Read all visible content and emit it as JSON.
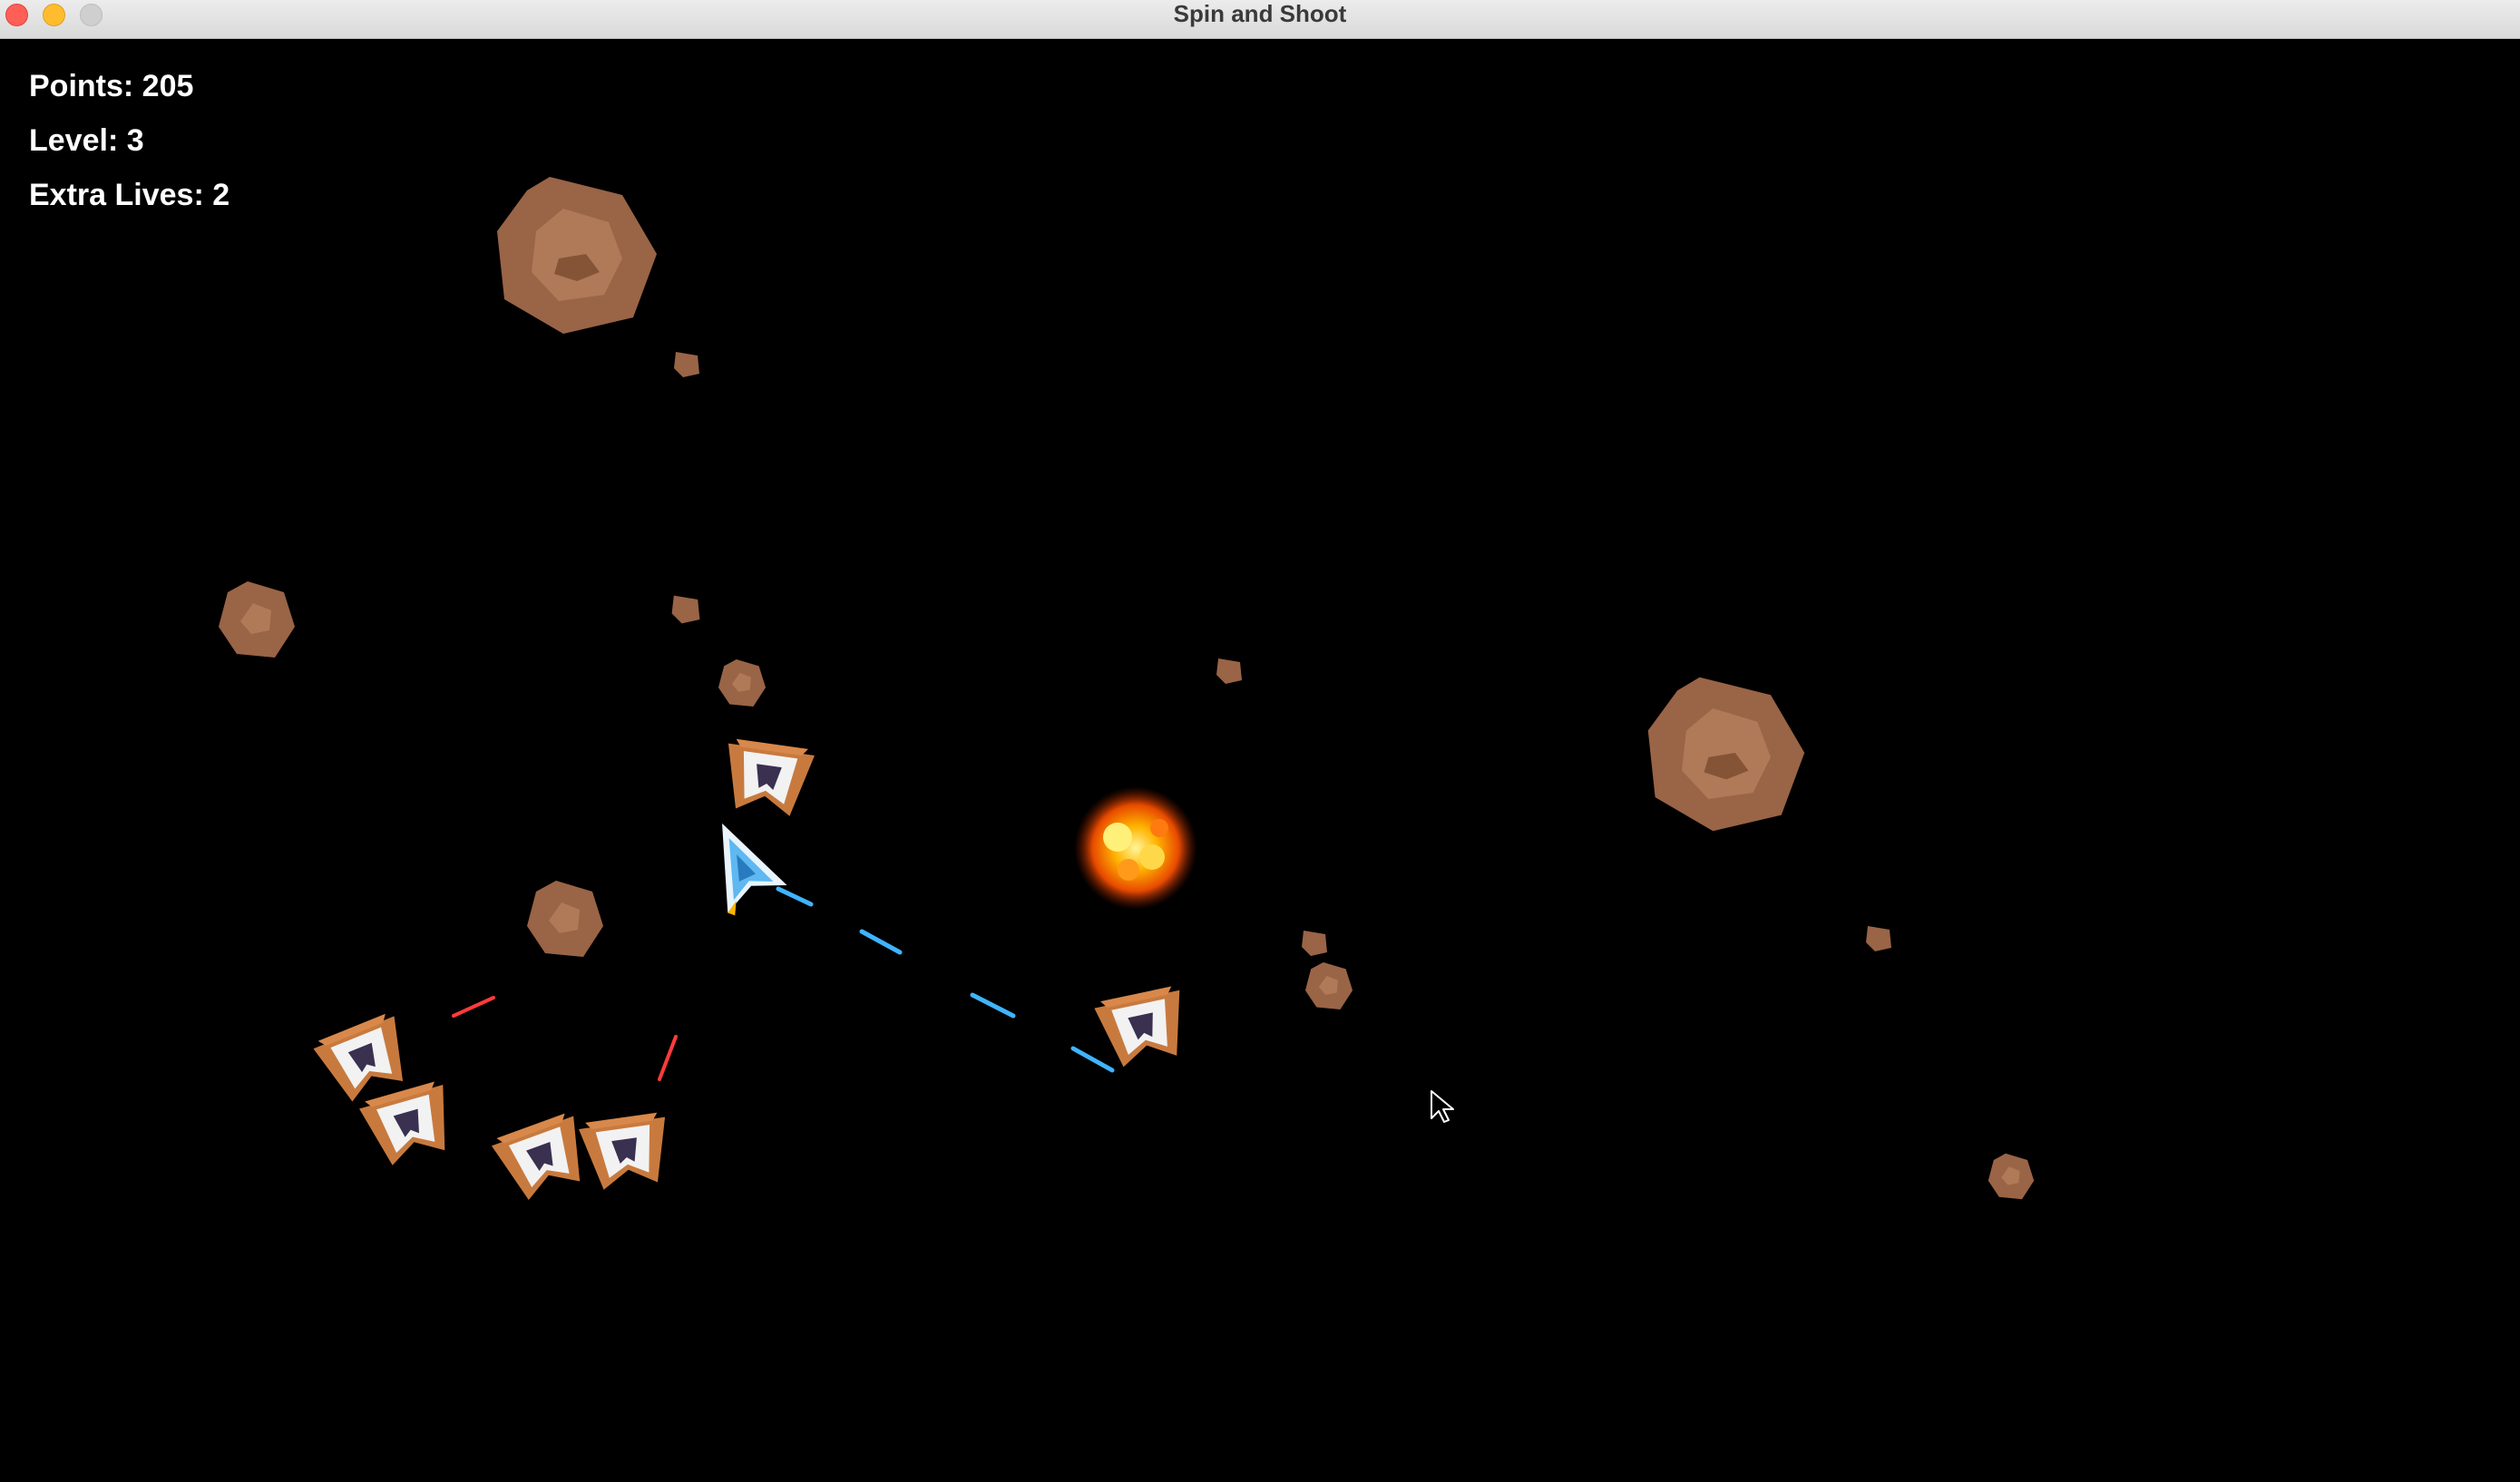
{
  "window": {
    "title": "Spin and Shoot",
    "controls": [
      "close",
      "minimize",
      "zoom"
    ]
  },
  "hud": {
    "points": "Points: 205",
    "level": "Level: 3",
    "extra_lives": "Extra Lives: 2"
  },
  "colors": {
    "background": "#000000",
    "asteroid": "#a06a4a",
    "player_laser": "#3fb4ff",
    "enemy_laser": "#ff3b3b",
    "enemy_hull": "#c87a3e",
    "player_hull": "#5fb8f0"
  }
}
